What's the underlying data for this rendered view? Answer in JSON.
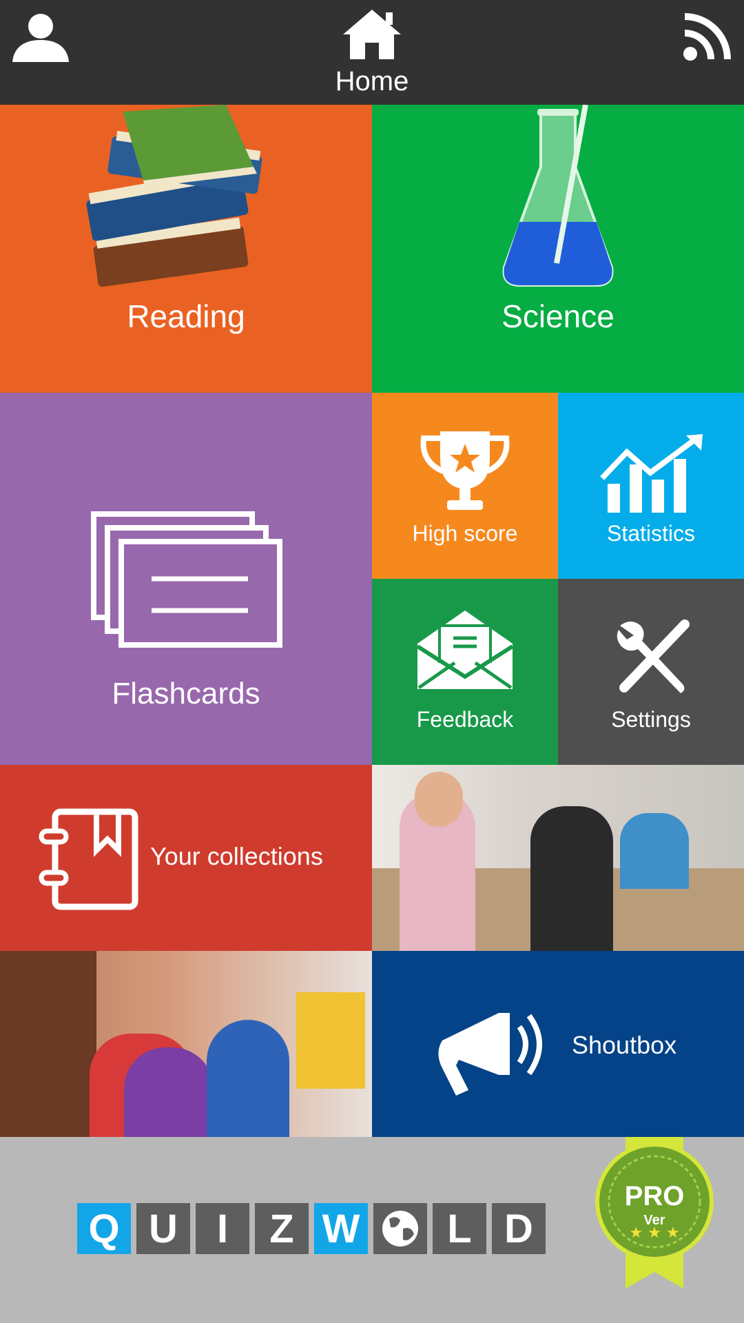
{
  "header": {
    "title": "Home",
    "left_icon": "user-icon",
    "center_icon": "home-icon",
    "right_icon": "rss-icon"
  },
  "tiles": {
    "reading": {
      "label": "Reading",
      "icon": "books-icon",
      "color": "#e96223"
    },
    "science": {
      "label": "Science",
      "icon": "flask-icon",
      "color": "#05ad43"
    },
    "flashcards": {
      "label": "Flashcards",
      "icon": "cards-icon",
      "color": "#9868ad"
    },
    "high_score": {
      "label": "High score",
      "icon": "trophy-icon",
      "color": "#f6891e"
    },
    "statistics": {
      "label": "Statistics",
      "icon": "chart-icon",
      "color": "#04adea"
    },
    "feedback": {
      "label": "Feedback",
      "icon": "envelope-icon",
      "color": "#18994a"
    },
    "settings": {
      "label": "Settings",
      "icon": "tools-icon",
      "color": "#4f4f4f"
    },
    "collections": {
      "label": "Your collections",
      "icon": "notebook-icon",
      "color": "#cf3c2e"
    },
    "shoutbox": {
      "label": "Shoutbox",
      "icon": "megaphone-icon",
      "color": "#044387"
    }
  },
  "footer": {
    "logo_letters": [
      "Q",
      "U",
      "I",
      "Z",
      "W",
      "O",
      "L",
      "D"
    ],
    "badge_text": "PRO",
    "badge_sub": "Ver"
  }
}
